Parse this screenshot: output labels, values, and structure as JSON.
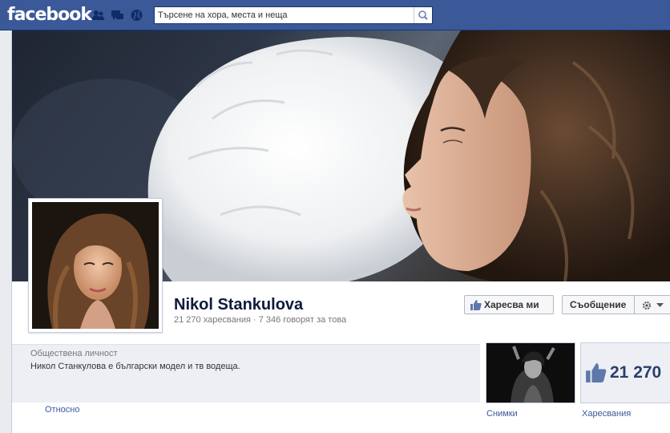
{
  "header": {
    "logo": "facebook",
    "search_placeholder": "Търсене на хора, места и неща",
    "jewels": [
      "friend-requests-icon",
      "messages-icon",
      "notifications-globe-icon"
    ],
    "colors": {
      "bar": "#3b5998",
      "page_bg": "#e9ebee"
    }
  },
  "profile": {
    "name": "Nikol Stankulova",
    "stats": "21 270 харесвания · 7 346 говорят за това",
    "buttons": {
      "like": "Харесва ми",
      "message": "Съобщение"
    }
  },
  "about": {
    "category": "Обществена личност",
    "description": "Никол Станкулова е български модел и тв водеща.",
    "link": "Относно"
  },
  "apps": {
    "photos_label": "Снимки",
    "likes_label": "Харесвания",
    "likes_count": "21 270"
  }
}
